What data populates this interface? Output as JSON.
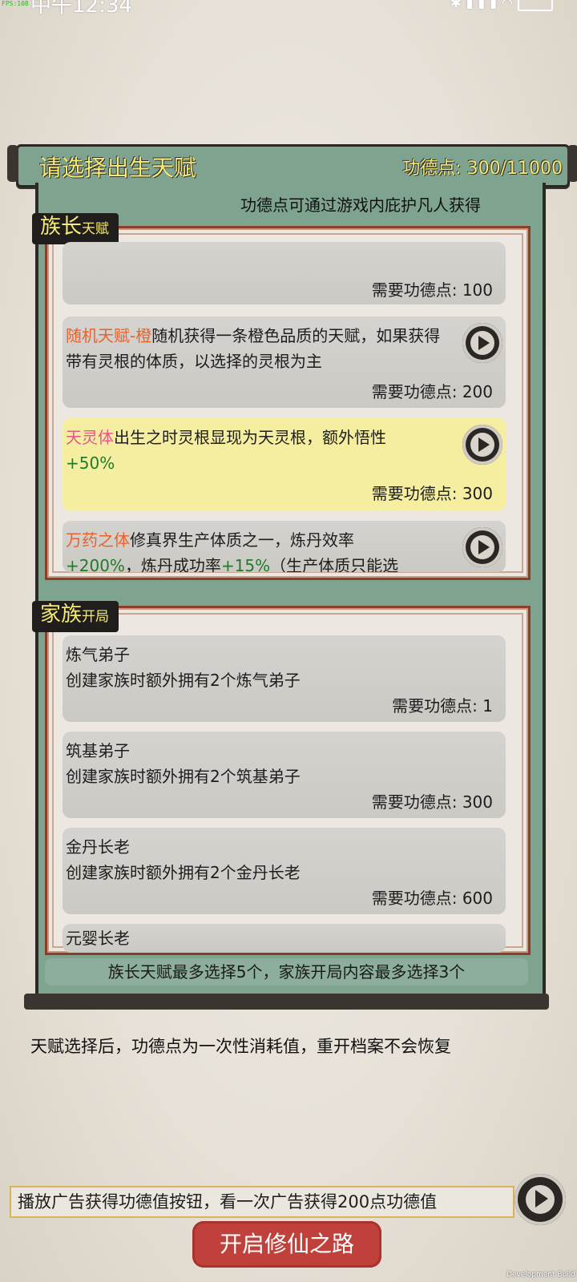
{
  "status_bar": {
    "fps": "FPS:108",
    "time": "中午12:34"
  },
  "header": {
    "title": "请选择出生天赋",
    "merit": "功德点: 300/11000"
  },
  "hint_top": "功德点可通过游戏内庇护凡人获得",
  "sections": {
    "clan_leader": {
      "label": "族长",
      "sublabel": "天赋"
    },
    "family": {
      "label": "家族",
      "sublabel": "开局"
    }
  },
  "talents": [
    {
      "cost": "需要功德点: 100"
    },
    {
      "name": "随机天赋-橙",
      "desc": "随机获得一条橙色品质的天赋，如果获得带有灵根的体质，以选择的灵根为主",
      "cost": "需要功德点: 200"
    },
    {
      "name": "天灵体",
      "desc": "出生之时灵根显现为天灵根，额外悟性",
      "bonus": "+50%",
      "cost": "需要功德点: 300"
    },
    {
      "name": "万药之体",
      "desc1": "修真界生产体质之一，炼丹效率",
      "bonus1": "+200%",
      "desc2": "，炼丹成功率",
      "bonus2": "+15%",
      "desc3": "（生产体质只能选"
    }
  ],
  "family_items": [
    {
      "name": "炼气弟子",
      "desc": "创建家族时额外拥有2个炼气弟子",
      "cost": "需要功德点: 1"
    },
    {
      "name": "筑基弟子",
      "desc": "创建家族时额外拥有2个筑基弟子",
      "cost": "需要功德点: 300"
    },
    {
      "name": "金丹长老",
      "desc": "创建家族时额外拥有2个金丹长老",
      "cost": "需要功德点: 600"
    },
    {
      "name": "元婴长老"
    }
  ],
  "limit_text": "族长天赋最多选择5个，家族开局内容最多选择3个",
  "warning": "天赋选择后，功德点为一次性消耗值，重开档案不会恢复",
  "ad_text": "播放广告获得功德值按钮，看一次广告获得200点功德值",
  "start_button": "开启修仙之路",
  "dev_build": "Development Build",
  "colors": {
    "panel_green": "#7ea38f",
    "title_yellow": "#f6ea74",
    "orange": "#e7622d",
    "pink": "#e4568a",
    "green": "#217a2a",
    "selected": "#f5eea0",
    "start_red": "#c0403b"
  },
  "icons": [
    "play-icon",
    "bluetooth-icon",
    "signal-icon",
    "wifi-icon",
    "battery-icon"
  ]
}
